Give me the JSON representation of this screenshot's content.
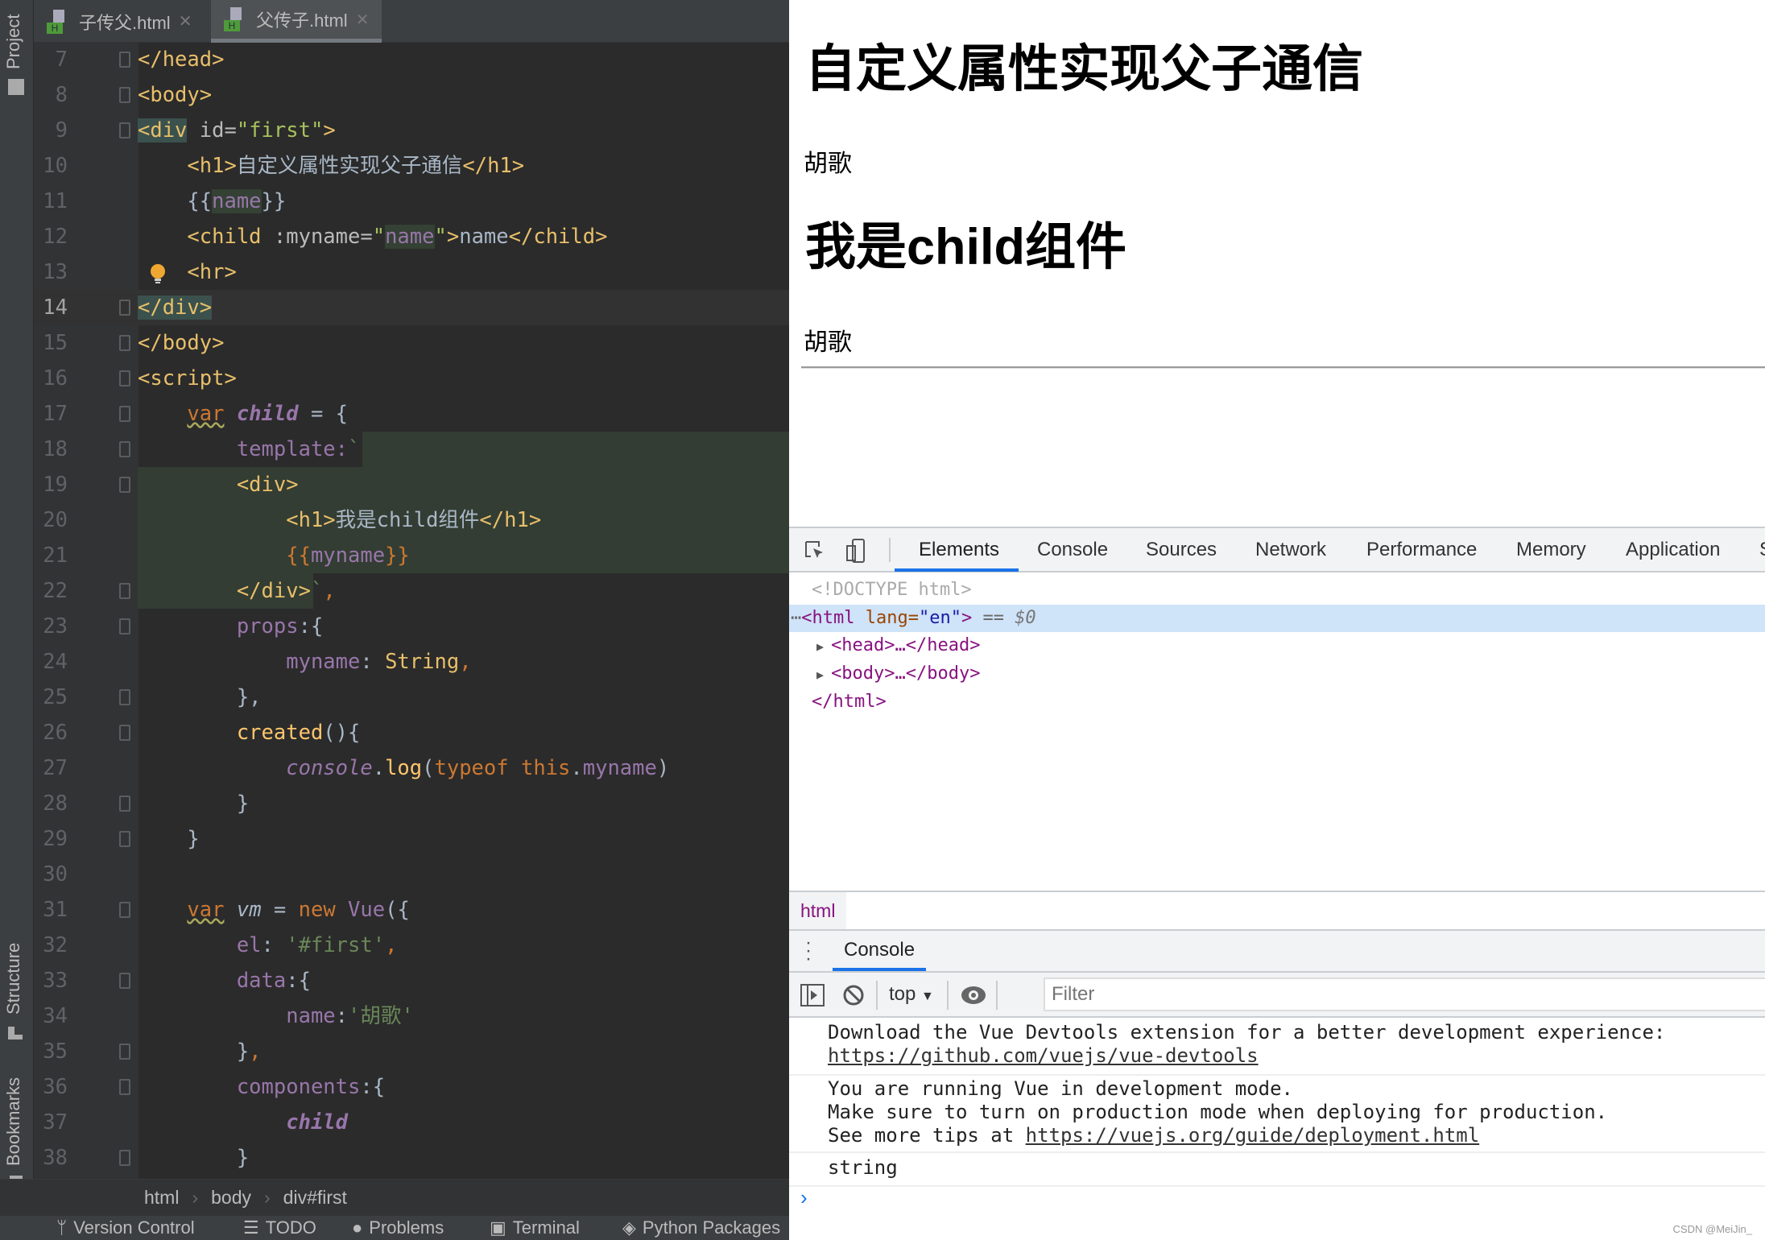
{
  "ide": {
    "side_labels": {
      "project": "Project",
      "structure": "Structure",
      "bookmarks": "Bookmarks"
    },
    "tabs": [
      {
        "label": "子传父.html",
        "active": false
      },
      {
        "label": "父传子.html",
        "active": true
      }
    ],
    "current_line": 14,
    "lines": [
      {
        "n": "7",
        "t": [
          [
            "</head>",
            "tag"
          ]
        ]
      },
      {
        "n": "8",
        "t": [
          [
            "<body>",
            "tag"
          ]
        ]
      },
      {
        "n": "9",
        "t": [
          [
            "<div",
            "brt"
          ],
          [
            " id=",
            "attr"
          ],
          [
            "\"first\"",
            "str"
          ],
          [
            ">",
            "tag"
          ]
        ]
      },
      {
        "n": "10",
        "t": [
          [
            "    ",
            ""
          ],
          [
            "<h1>",
            "tag"
          ],
          [
            "自定义属性实现父子通信",
            "text"
          ],
          [
            "</h1>",
            "tag"
          ]
        ]
      },
      {
        "n": "11",
        "t": [
          [
            "    {{",
            "text"
          ],
          [
            "name",
            "purple hl"
          ],
          [
            "}}",
            "text"
          ]
        ]
      },
      {
        "n": "12",
        "t": [
          [
            "    ",
            ""
          ],
          [
            "<child",
            "tag"
          ],
          [
            " :myname=",
            "attr"
          ],
          [
            "\"",
            "str"
          ],
          [
            "name",
            "purple hl"
          ],
          [
            "\"",
            "str"
          ],
          [
            ">",
            "tag"
          ],
          [
            "name",
            "text"
          ],
          [
            "</child>",
            "tag"
          ]
        ]
      },
      {
        "n": "13",
        "t": [
          [
            "    ",
            ""
          ],
          [
            "<hr>",
            "tag"
          ]
        ]
      },
      {
        "n": "14",
        "t": [
          [
            "</div>",
            "brt"
          ]
        ]
      },
      {
        "n": "15",
        "t": [
          [
            "</body>",
            "tag"
          ]
        ]
      },
      {
        "n": "16",
        "t": [
          [
            "<script>",
            "tag"
          ]
        ]
      },
      {
        "n": "17",
        "t": [
          [
            "    ",
            ""
          ],
          [
            "var",
            "kwu"
          ],
          [
            " ",
            ""
          ],
          [
            "child",
            "pi"
          ],
          [
            " = {",
            "text"
          ]
        ]
      },
      {
        "n": "18",
        "t": [
          [
            "        ",
            ""
          ],
          [
            "template:",
            "purple"
          ],
          [
            "`",
            "g"
          ]
        ]
      },
      {
        "n": "19",
        "t": [
          [
            "        ",
            ""
          ],
          [
            "<div>",
            "tag"
          ]
        ]
      },
      {
        "n": "20",
        "t": [
          [
            "            ",
            ""
          ],
          [
            "<h1>",
            "tag"
          ],
          [
            "我是child组件",
            "text"
          ],
          [
            "</h1>",
            "tag"
          ]
        ]
      },
      {
        "n": "21",
        "t": [
          [
            "            ",
            ""
          ],
          [
            "{{",
            "kw"
          ],
          [
            "myname",
            "purple"
          ],
          [
            "}}",
            "kw"
          ]
        ]
      },
      {
        "n": "22",
        "t": [
          [
            "        ",
            ""
          ],
          [
            "</div>",
            "tag"
          ],
          [
            "`",
            "g"
          ],
          [
            ",",
            "kw"
          ]
        ]
      },
      {
        "n": "23",
        "t": [
          [
            "        ",
            ""
          ],
          [
            "props",
            "purple"
          ],
          [
            ":{",
            "text"
          ]
        ]
      },
      {
        "n": "24",
        "t": [
          [
            "            ",
            ""
          ],
          [
            "myname",
            "purple"
          ],
          [
            ": ",
            "text"
          ],
          [
            "String",
            "tag"
          ],
          [
            ",",
            "kw"
          ]
        ]
      },
      {
        "n": "25",
        "t": [
          [
            "        },",
            "text"
          ]
        ]
      },
      {
        "n": "26",
        "t": [
          [
            "        ",
            ""
          ],
          [
            "created",
            "fn"
          ],
          [
            "(){",
            "text"
          ]
        ]
      },
      {
        "n": "27",
        "t": [
          [
            "            ",
            ""
          ],
          [
            "console",
            "ital"
          ],
          [
            ".",
            "text"
          ],
          [
            "log",
            "fn"
          ],
          [
            "(",
            "text"
          ],
          [
            "typeof",
            "kw"
          ],
          [
            " ",
            ""
          ],
          [
            "this",
            "kw"
          ],
          [
            ".",
            "text"
          ],
          [
            "myname",
            "purple"
          ],
          [
            ")",
            "text"
          ]
        ]
      },
      {
        "n": "28",
        "t": [
          [
            "        }",
            "text"
          ]
        ]
      },
      {
        "n": "29",
        "t": [
          [
            "    }",
            "text"
          ]
        ]
      },
      {
        "n": "30",
        "t": []
      },
      {
        "n": "31",
        "t": [
          [
            "    ",
            ""
          ],
          [
            "var",
            "kwu"
          ],
          [
            " vm",
            "gray"
          ],
          [
            " = ",
            "text"
          ],
          [
            "new",
            "kw"
          ],
          [
            " Vue",
            "purple"
          ],
          [
            "({",
            "text"
          ]
        ]
      },
      {
        "n": "32",
        "t": [
          [
            "        ",
            ""
          ],
          [
            "el",
            "purple"
          ],
          [
            ": ",
            "text"
          ],
          [
            "'#first'",
            "g"
          ],
          [
            ",",
            "kw"
          ]
        ]
      },
      {
        "n": "33",
        "t": [
          [
            "        ",
            ""
          ],
          [
            "data",
            "purple"
          ],
          [
            ":{",
            "text"
          ]
        ]
      },
      {
        "n": "34",
        "t": [
          [
            "            ",
            ""
          ],
          [
            "name",
            "purple"
          ],
          [
            ":",
            "text"
          ],
          [
            "'胡歌'",
            "g"
          ]
        ]
      },
      {
        "n": "35",
        "t": [
          [
            "        }",
            "text"
          ],
          [
            ",",
            "kw"
          ]
        ]
      },
      {
        "n": "36",
        "t": [
          [
            "        ",
            ""
          ],
          [
            "components",
            "purple"
          ],
          [
            ":{",
            "text"
          ]
        ]
      },
      {
        "n": "37",
        "t": [
          [
            "            ",
            ""
          ],
          [
            "child",
            "pi"
          ]
        ]
      },
      {
        "n": "38",
        "t": [
          [
            "        }",
            "text"
          ]
        ]
      }
    ],
    "breadcrumb": [
      "html",
      "body",
      "div#first"
    ],
    "bottom_tools": [
      "Version Control",
      "TODO",
      "Problems",
      "Terminal",
      "Python Packages"
    ]
  },
  "page": {
    "h1_parent": "自定义属性实现父子通信",
    "name_parent": "胡歌",
    "h1_child": "我是child组件",
    "name_child": "胡歌"
  },
  "devtools": {
    "tabs": [
      "Elements",
      "Console",
      "Sources",
      "Network",
      "Performance",
      "Memory",
      "Application",
      "S"
    ],
    "active_tab": "Elements",
    "dom": {
      "doctype": "<!DOCTYPE html>",
      "html_open": "<html",
      "lang_attr": " lang=",
      "lang_val": "\"en\"",
      "close": ">",
      "eq": " == ",
      "dollar": "$0",
      "head": "<head>…</head>",
      "body": "<body>…</body>",
      "html_close": "</html>"
    },
    "crumb": "html",
    "drawer_tab": "Console",
    "context": "top",
    "filter_placeholder": "Filter",
    "messages": {
      "m1": "Download the Vue Devtools extension for a better development experience:",
      "m1_link": "https://github.com/vuejs/vue-devtools",
      "m2a": "You are running Vue in development mode.",
      "m2b": "Make sure to turn on production mode when deploying for production.",
      "m2c": "See more tips at ",
      "m2_link": "https://vuejs.org/guide/deployment.html",
      "m3": "string"
    }
  },
  "watermark": "CSDN @MeiJin_"
}
